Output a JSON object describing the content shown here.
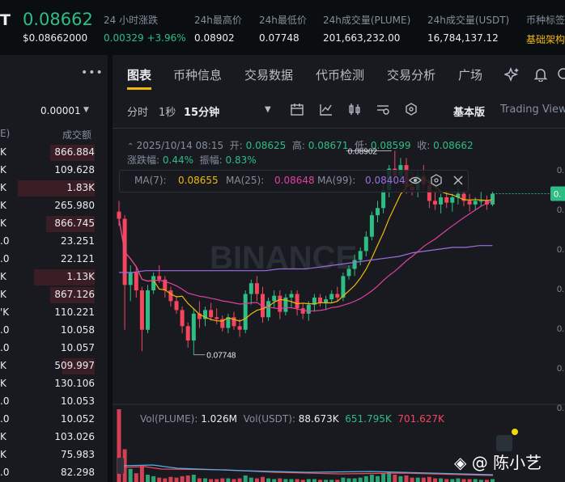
{
  "ticker": {
    "symbol_tail": "T",
    "price": "0.08662",
    "price_usd": "$0.08662000"
  },
  "stats": [
    {
      "label": "24 小时涨跌",
      "value": "0.00329 +3.96%"
    },
    {
      "label": "24h最高价",
      "value": "0.08902"
    },
    {
      "label": "24h最低价",
      "value": "0.07748"
    },
    {
      "label": "24h成交量(PLUME)",
      "value": "201,663,232.00"
    },
    {
      "label": "24h成交量(USDT)",
      "value": "16,784,137.12"
    },
    {
      "label": "币种标签",
      "value": "基础架构"
    }
  ],
  "orderbook": {
    "more_icon": "more-dots-icon",
    "tick_size": "0.00001",
    "header_left": "E)",
    "header_right": "成交额",
    "rows": [
      {
        "left": "K",
        "right": "866.884",
        "depth": 0.55
      },
      {
        "left": "K",
        "right": "109.628",
        "depth": 0.0
      },
      {
        "left": "K",
        "right": "1.83K",
        "depth": 0.95
      },
      {
        "left": "K",
        "right": "265.980",
        "depth": 0.0
      },
      {
        "left": "K",
        "right": "866.745",
        "depth": 0.6
      },
      {
        "left": ".0",
        "right": "23.251",
        "depth": 0.0
      },
      {
        "left": ".0",
        "right": "22.121",
        "depth": 0.0
      },
      {
        "left": "K",
        "right": "1.13K",
        "depth": 0.75
      },
      {
        "left": "K",
        "right": "867.126",
        "depth": 0.55
      },
      {
        "left": "'K",
        "right": "110.221",
        "depth": 0.0
      },
      {
        "left": ".0",
        "right": "10.058",
        "depth": 0.0
      },
      {
        "left": ".0",
        "right": "10.057",
        "depth": 0.0
      },
      {
        "left": "K",
        "right": "509.997",
        "depth": 0.4
      },
      {
        "left": "K",
        "right": "130.106",
        "depth": 0.0
      },
      {
        "left": ".0",
        "right": "10.053",
        "depth": 0.0
      },
      {
        "left": ".0",
        "right": "10.052",
        "depth": 0.0
      },
      {
        "left": "K",
        "right": "103.026",
        "depth": 0.0
      },
      {
        "left": "K",
        "right": "75.983",
        "depth": 0.0
      },
      {
        "left": ".0",
        "right": "82.298",
        "depth": 0.0
      }
    ]
  },
  "tabs": [
    "图表",
    "币种信息",
    "交易数据",
    "代币检测",
    "交易分析",
    "广场"
  ],
  "toolbar": {
    "timeframes": [
      "分时",
      "1秒",
      "15分钟"
    ],
    "version": "基本版",
    "tradingview": "Trading View"
  },
  "candle_info": {
    "date": "2025/10/14 08:15",
    "open_label": "开:",
    "open": "0.08625",
    "high_label": "高:",
    "high": "0.08671",
    "low_label": "低:",
    "low": "0.08599",
    "close_label": "收:",
    "close": "0.08662",
    "change_label": "涨跌幅:",
    "change": "0.44%",
    "amp_label": "振幅:",
    "amp": "0.83%"
  },
  "ma": {
    "ma7_label": "MA(7):",
    "ma7": "0.08655",
    "ma25_label": "MA(25):",
    "ma25": "0.08648",
    "ma99_label": "MA(99):",
    "ma99": "0.08404"
  },
  "chart_data": {
    "type": "candlestick",
    "max_label": "0.08902",
    "min_label": "0.07748",
    "watermark": "BINANCE",
    "axis_right_labels": [
      "0.",
      "0.",
      "0.",
      "0.",
      "0.",
      "0.",
      "0."
    ],
    "current_price_tag": "0.",
    "candles": [
      [
        0.0856,
        0.0862,
        0.0848,
        0.0852
      ],
      [
        0.0852,
        0.0854,
        0.079,
        0.0815
      ],
      [
        0.0815,
        0.0826,
        0.0806,
        0.0822
      ],
      [
        0.0822,
        0.0825,
        0.0808,
        0.0812
      ],
      [
        0.0812,
        0.0814,
        0.0778,
        0.079
      ],
      [
        0.079,
        0.0815,
        0.0788,
        0.0812
      ],
      [
        0.0812,
        0.0822,
        0.081,
        0.082
      ],
      [
        0.082,
        0.0826,
        0.0816,
        0.0818
      ],
      [
        0.0818,
        0.082,
        0.0808,
        0.0812
      ],
      [
        0.0812,
        0.0814,
        0.0803,
        0.0806
      ],
      [
        0.0806,
        0.0809,
        0.0799,
        0.0801
      ],
      [
        0.0801,
        0.0803,
        0.0788,
        0.0792
      ],
      [
        0.0792,
        0.0794,
        0.078,
        0.0784
      ],
      [
        0.0784,
        0.0802,
        0.0776,
        0.0799
      ],
      [
        0.0799,
        0.0806,
        0.0791,
        0.0796
      ],
      [
        0.0796,
        0.0803,
        0.0792,
        0.0801
      ],
      [
        0.0801,
        0.0805,
        0.0795,
        0.0797
      ],
      [
        0.0797,
        0.0802,
        0.0793,
        0.0796
      ],
      [
        0.0796,
        0.0798,
        0.0789,
        0.0791
      ],
      [
        0.0791,
        0.0799,
        0.0788,
        0.0797
      ],
      [
        0.0797,
        0.08,
        0.079,
        0.0792
      ],
      [
        0.0792,
        0.0796,
        0.0786,
        0.079
      ],
      [
        0.079,
        0.0812,
        0.0788,
        0.081
      ],
      [
        0.081,
        0.0818,
        0.0804,
        0.0816
      ],
      [
        0.0816,
        0.082,
        0.0806,
        0.081
      ],
      [
        0.081,
        0.0814,
        0.0794,
        0.0797
      ],
      [
        0.0797,
        0.0808,
        0.0795,
        0.0806
      ],
      [
        0.0806,
        0.0812,
        0.0802,
        0.0809
      ],
      [
        0.0809,
        0.0812,
        0.0796,
        0.08
      ],
      [
        0.08,
        0.081,
        0.0798,
        0.0808
      ],
      [
        0.0808,
        0.0812,
        0.0802,
        0.081
      ],
      [
        0.081,
        0.0812,
        0.0798,
        0.0802
      ],
      [
        0.0802,
        0.0805,
        0.0796,
        0.0799
      ],
      [
        0.0799,
        0.0806,
        0.0795,
        0.0804
      ],
      [
        0.0804,
        0.081,
        0.08,
        0.0808
      ],
      [
        0.0808,
        0.081,
        0.0803,
        0.0805
      ],
      [
        0.0805,
        0.0809,
        0.0801,
        0.0807
      ],
      [
        0.0807,
        0.0812,
        0.0805,
        0.081
      ],
      [
        0.081,
        0.0814,
        0.0806,
        0.0808
      ],
      [
        0.0808,
        0.0822,
        0.0806,
        0.082
      ],
      [
        0.082,
        0.0826,
        0.0818,
        0.0824
      ],
      [
        0.0824,
        0.0832,
        0.082,
        0.0829
      ],
      [
        0.0829,
        0.0836,
        0.0826,
        0.0834
      ],
      [
        0.0834,
        0.0845,
        0.0831,
        0.0842
      ],
      [
        0.0842,
        0.0856,
        0.084,
        0.0854
      ],
      [
        0.0854,
        0.0862,
        0.085,
        0.0858
      ],
      [
        0.0858,
        0.0872,
        0.0855,
        0.0868
      ],
      [
        0.0868,
        0.0882,
        0.0864,
        0.088
      ],
      [
        0.088,
        0.089,
        0.0871,
        0.0876
      ],
      [
        0.0876,
        0.0886,
        0.0874,
        0.0882
      ],
      [
        0.0882,
        0.0886,
        0.0866,
        0.087
      ],
      [
        0.087,
        0.0878,
        0.0865,
        0.0868
      ],
      [
        0.0868,
        0.0879,
        0.0864,
        0.0876
      ],
      [
        0.0876,
        0.0882,
        0.0868,
        0.0871
      ],
      [
        0.0871,
        0.0874,
        0.0858,
        0.0862
      ],
      [
        0.0862,
        0.0868,
        0.0857,
        0.086
      ],
      [
        0.086,
        0.0866,
        0.0855,
        0.0864
      ],
      [
        0.0864,
        0.0868,
        0.0858,
        0.0861
      ],
      [
        0.0861,
        0.0866,
        0.0856,
        0.0864
      ],
      [
        0.0864,
        0.0872,
        0.086,
        0.0866
      ],
      [
        0.0866,
        0.0868,
        0.0859,
        0.0862
      ],
      [
        0.0862,
        0.0866,
        0.0856,
        0.086
      ],
      [
        0.086,
        0.0864,
        0.0857,
        0.0862
      ],
      [
        0.0862,
        0.0867,
        0.0859,
        0.0862
      ],
      [
        0.0862,
        0.0865,
        0.0857,
        0.086
      ],
      [
        0.086,
        0.0867,
        0.0859,
        0.0866
      ]
    ],
    "ma99": [
      0.0822,
      0.0822,
      0.0823,
      0.0823,
      0.0823,
      0.0823,
      0.0823,
      0.0823,
      0.0823,
      0.0823,
      0.0823,
      0.0823,
      0.0824,
      0.0824,
      0.0824,
      0.0825,
      0.0826,
      0.0827,
      0.0828,
      0.0829,
      0.083,
      0.0831,
      0.0833,
      0.0834,
      0.0835,
      0.0836,
      0.0836,
      0.0837,
      0.0837
    ],
    "volume": [
      {
        "value": 1.0,
        "color": "red"
      },
      {
        "value": 0.45,
        "color": "red"
      },
      {
        "value": 0.18,
        "color": "green"
      },
      {
        "value": 0.12,
        "color": "red"
      },
      {
        "value": 0.22,
        "color": "red"
      },
      {
        "value": 0.1,
        "color": "green"
      },
      {
        "value": 0.08,
        "color": "green"
      },
      {
        "value": 0.06,
        "color": "red"
      },
      {
        "value": 0.05,
        "color": "red"
      },
      {
        "value": 0.07,
        "color": "red"
      },
      {
        "value": 0.06,
        "color": "red"
      },
      {
        "value": 0.08,
        "color": "red"
      },
      {
        "value": 0.09,
        "color": "red"
      },
      {
        "value": 0.1,
        "color": "green"
      },
      {
        "value": 0.05,
        "color": "red"
      },
      {
        "value": 0.05,
        "color": "green"
      },
      {
        "value": 0.04,
        "color": "red"
      },
      {
        "value": 0.04,
        "color": "red"
      },
      {
        "value": 0.05,
        "color": "red"
      },
      {
        "value": 0.05,
        "color": "green"
      },
      {
        "value": 0.04,
        "color": "red"
      },
      {
        "value": 0.05,
        "color": "red"
      },
      {
        "value": 0.09,
        "color": "green"
      },
      {
        "value": 0.06,
        "color": "green"
      },
      {
        "value": 0.05,
        "color": "red"
      },
      {
        "value": 0.07,
        "color": "red"
      },
      {
        "value": 0.05,
        "color": "green"
      },
      {
        "value": 0.04,
        "color": "green"
      },
      {
        "value": 0.05,
        "color": "red"
      },
      {
        "value": 0.04,
        "color": "green"
      },
      {
        "value": 0.04,
        "color": "green"
      },
      {
        "value": 0.04,
        "color": "red"
      },
      {
        "value": 0.03,
        "color": "red"
      },
      {
        "value": 0.04,
        "color": "green"
      },
      {
        "value": 0.04,
        "color": "green"
      },
      {
        "value": 0.03,
        "color": "red"
      },
      {
        "value": 0.03,
        "color": "green"
      },
      {
        "value": 0.03,
        "color": "green"
      },
      {
        "value": 0.03,
        "color": "red"
      },
      {
        "value": 0.06,
        "color": "green"
      },
      {
        "value": 0.05,
        "color": "green"
      },
      {
        "value": 0.05,
        "color": "green"
      },
      {
        "value": 0.06,
        "color": "green"
      },
      {
        "value": 0.08,
        "color": "green"
      },
      {
        "value": 0.1,
        "color": "green"
      },
      {
        "value": 0.08,
        "color": "green"
      },
      {
        "value": 0.12,
        "color": "green"
      },
      {
        "value": 0.14,
        "color": "green"
      },
      {
        "value": 0.1,
        "color": "red"
      },
      {
        "value": 0.08,
        "color": "green"
      },
      {
        "value": 0.09,
        "color": "red"
      },
      {
        "value": 0.06,
        "color": "red"
      },
      {
        "value": 0.06,
        "color": "green"
      },
      {
        "value": 0.06,
        "color": "red"
      },
      {
        "value": 0.07,
        "color": "red"
      },
      {
        "value": 0.05,
        "color": "red"
      },
      {
        "value": 0.05,
        "color": "green"
      },
      {
        "value": 0.04,
        "color": "red"
      },
      {
        "value": 0.04,
        "color": "green"
      },
      {
        "value": 0.05,
        "color": "green"
      },
      {
        "value": 0.04,
        "color": "red"
      },
      {
        "value": 0.04,
        "color": "red"
      },
      {
        "value": 0.04,
        "color": "green"
      },
      {
        "value": 0.03,
        "color": "green"
      },
      {
        "value": 0.03,
        "color": "red"
      },
      {
        "value": 0.04,
        "color": "green"
      }
    ]
  },
  "volume_info": {
    "vol_label": "Vol(PLUME):",
    "vol": "1.026M",
    "usdt_label": "Vol(USDT):",
    "usdt": "88.673K",
    "v2": "651.795K",
    "v3": "701.627K"
  },
  "watermark_text": "@ 陈小艺",
  "colors": {
    "up": "#2ebd85",
    "down": "#f6465d",
    "ma7": "#f0b90b",
    "ma25": "#e040a0",
    "ma99": "#9b6fe0",
    "accent": "#f0b90b"
  }
}
